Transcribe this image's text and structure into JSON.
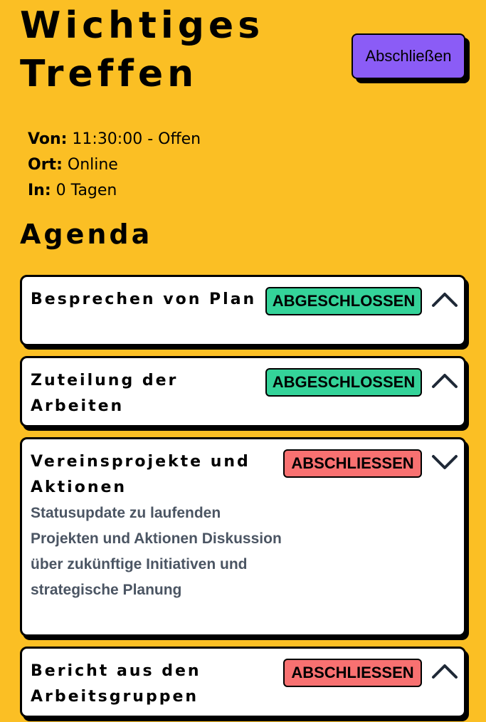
{
  "header": {
    "title": "Wichtiges Treffen",
    "finish_label": "Abschließen"
  },
  "meta": {
    "from_label": "Von:",
    "from_value": "11:30:00 - Offen",
    "place_label": "Ort:",
    "place_value": "Online",
    "in_label": "In:",
    "in_value": "0 Tagen"
  },
  "agenda": {
    "heading": "Agenda",
    "items": [
      {
        "title": "Besprechen von Plan",
        "status": "ABGESCHLOSSEN",
        "expanded": false,
        "chevron": "chevron-up-icon",
        "description": ""
      },
      {
        "title": "Zuteilung der Arbeiten",
        "status": "ABGESCHLOSSEN",
        "expanded": false,
        "chevron": "chevron-up-icon",
        "description": ""
      },
      {
        "title": "Vereinsprojekte und Aktionen",
        "status": "ABSCHLIESSEN",
        "expanded": true,
        "chevron": "chevron-down-icon",
        "description": "Statusupdate zu laufenden Projekten und Aktionen Diskussion über zukünftige Initiativen und strategische Planung"
      },
      {
        "title": "Bericht aus den Arbeitsgruppen",
        "status": "ABSCHLIESSEN",
        "expanded": false,
        "chevron": "chevron-up-icon",
        "description": ""
      }
    ]
  },
  "colors": {
    "background": "#FBBF24",
    "finish_button": "#8B5CF6",
    "status_done": "#34D399",
    "status_todo": "#F87171",
    "description_text": "#4B5563"
  }
}
